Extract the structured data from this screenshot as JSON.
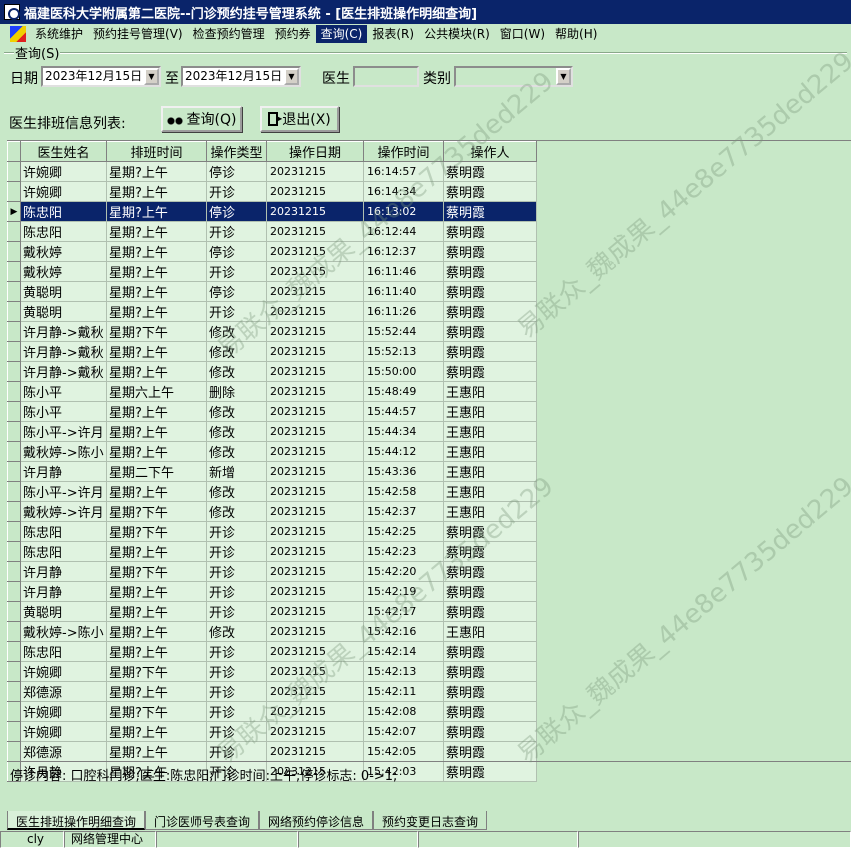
{
  "window": {
    "title": "福建医科大学附属第二医院--门诊预约挂号管理系统 - [医生排班操作明细查询]"
  },
  "menu": {
    "items": [
      {
        "label": "系统维护",
        "active": false
      },
      {
        "label": "预约挂号管理(V)",
        "active": false
      },
      {
        "label": "检查预约管理",
        "active": false
      },
      {
        "label": "预约券",
        "active": false
      },
      {
        "label": "查询(C)",
        "active": true
      },
      {
        "label": "报表(R)",
        "active": false
      },
      {
        "label": "公共模块(R)",
        "active": false
      },
      {
        "label": "窗口(W)",
        "active": false
      },
      {
        "label": "帮助(H)",
        "active": false
      }
    ]
  },
  "query": {
    "group_label": "查询(S)",
    "date_label": "日期",
    "date_from": "2023年12月15日",
    "to_label": "至",
    "date_to": "2023年12月15日",
    "doctor_label": "医生",
    "doctor_value": "",
    "category_label": "类别",
    "category_value": ""
  },
  "list": {
    "caption": "医生排班信息列表:",
    "query_button": "查询(Q)",
    "exit_button": "退出(X)",
    "columns": [
      "医生姓名",
      "排班时间",
      "操作类型",
      "操作日期",
      "操作时间",
      "操作人"
    ],
    "selected_index": 2,
    "rows": [
      [
        "许婉卿",
        "星期?上午",
        "停诊",
        "20231215",
        "16:14:57",
        "蔡明霞"
      ],
      [
        "许婉卿",
        "星期?上午",
        "开诊",
        "20231215",
        "16:14:34",
        "蔡明霞"
      ],
      [
        "陈忠阳",
        "星期?上午",
        "停诊",
        "20231215",
        "16:13:02",
        "蔡明霞"
      ],
      [
        "陈忠阳",
        "星期?上午",
        "开诊",
        "20231215",
        "16:12:44",
        "蔡明霞"
      ],
      [
        "戴秋婷",
        "星期?上午",
        "停诊",
        "20231215",
        "16:12:37",
        "蔡明霞"
      ],
      [
        "戴秋婷",
        "星期?上午",
        "开诊",
        "20231215",
        "16:11:46",
        "蔡明霞"
      ],
      [
        "黄聪明",
        "星期?上午",
        "停诊",
        "20231215",
        "16:11:40",
        "蔡明霞"
      ],
      [
        "黄聪明",
        "星期?上午",
        "开诊",
        "20231215",
        "16:11:26",
        "蔡明霞"
      ],
      [
        "许月静->戴秋",
        "星期?下午",
        "修改",
        "20231215",
        "15:52:44",
        "蔡明霞"
      ],
      [
        "许月静->戴秋",
        "星期?上午",
        "修改",
        "20231215",
        "15:52:13",
        "蔡明霞"
      ],
      [
        "许月静->戴秋",
        "星期?上午",
        "修改",
        "20231215",
        "15:50:00",
        "蔡明霞"
      ],
      [
        "陈小平",
        "星期六上午",
        "删除",
        "20231215",
        "15:48:49",
        "王惠阳"
      ],
      [
        "陈小平",
        "星期?上午",
        "修改",
        "20231215",
        "15:44:57",
        "王惠阳"
      ],
      [
        "陈小平->许月",
        "星期?上午",
        "修改",
        "20231215",
        "15:44:34",
        "王惠阳"
      ],
      [
        "戴秋婷->陈小",
        "星期?上午",
        "修改",
        "20231215",
        "15:44:12",
        "王惠阳"
      ],
      [
        "许月静",
        "星期二下午",
        "新增",
        "20231215",
        "15:43:36",
        "王惠阳"
      ],
      [
        "陈小平->许月",
        "星期?上午",
        "修改",
        "20231215",
        "15:42:58",
        "王惠阳"
      ],
      [
        "戴秋婷->许月",
        "星期?下午",
        "修改",
        "20231215",
        "15:42:37",
        "王惠阳"
      ],
      [
        "陈忠阳",
        "星期?下午",
        "开诊",
        "20231215",
        "15:42:25",
        "蔡明霞"
      ],
      [
        "陈忠阳",
        "星期?上午",
        "开诊",
        "20231215",
        "15:42:23",
        "蔡明霞"
      ],
      [
        "许月静",
        "星期?下午",
        "开诊",
        "20231215",
        "15:42:20",
        "蔡明霞"
      ],
      [
        "许月静",
        "星期?上午",
        "开诊",
        "20231215",
        "15:42:19",
        "蔡明霞"
      ],
      [
        "黄聪明",
        "星期?上午",
        "开诊",
        "20231215",
        "15:42:17",
        "蔡明霞"
      ],
      [
        "戴秋婷->陈小",
        "星期?上午",
        "修改",
        "20231215",
        "15:42:16",
        "王惠阳"
      ],
      [
        "陈忠阳",
        "星期?上午",
        "开诊",
        "20231215",
        "15:42:14",
        "蔡明霞"
      ],
      [
        "许婉卿",
        "星期?下午",
        "开诊",
        "20231215",
        "15:42:13",
        "蔡明霞"
      ],
      [
        "郑德源",
        "星期?上午",
        "开诊",
        "20231215",
        "15:42:11",
        "蔡明霞"
      ],
      [
        "许婉卿",
        "星期?下午",
        "开诊",
        "20231215",
        "15:42:08",
        "蔡明霞"
      ],
      [
        "许婉卿",
        "星期?上午",
        "开诊",
        "20231215",
        "15:42:07",
        "蔡明霞"
      ],
      [
        "郑德源",
        "星期?上午",
        "开诊",
        "20231215",
        "15:42:05",
        "蔡明霞"
      ],
      [
        "许月静",
        "星期?上午",
        "开诊",
        "20231215",
        "15:42:03",
        "蔡明霞"
      ]
    ]
  },
  "detail": {
    "text": "停诊内容: 口腔科门诊;医生:陈忠阳;门诊时间:上午;停诊标志: 0->1;"
  },
  "tabs": [
    {
      "label": "医生排班操作明细查询",
      "active": true
    },
    {
      "label": "门诊医师号表查询",
      "active": false
    },
    {
      "label": "网络预约停诊信息",
      "active": false
    },
    {
      "label": "预约变更日志查询",
      "active": false
    }
  ],
  "status": {
    "user": "cly",
    "center": "网络管理中心"
  },
  "watermark": {
    "text": "易联众_魏成果_44e8e7735ded229"
  }
}
